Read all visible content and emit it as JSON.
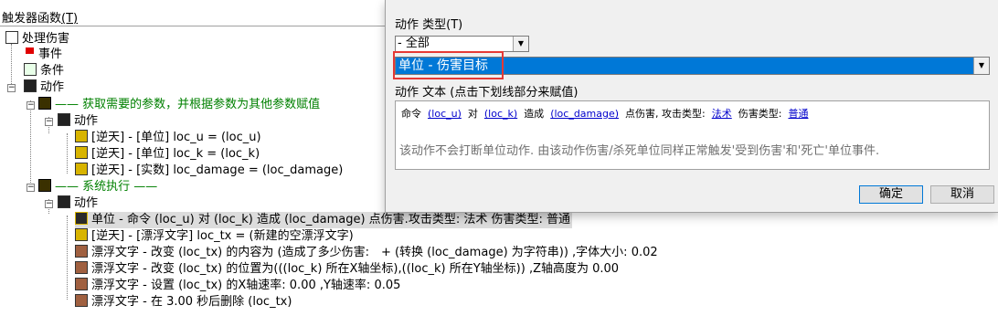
{
  "panel": {
    "title": "触发器函数",
    "title_key": "(T)"
  },
  "tree": {
    "root": "处理伤害",
    "events": "事件",
    "conditions": "条件",
    "actions": "动作",
    "comment1": "—— 获取需要的参数，并根据参数为其他参数赋值",
    "sub_actions1": "动作",
    "set_u": "[逆天] - [单位] loc_u = (loc_u)",
    "set_k": "[逆天] - [单位] loc_k = (loc_k)",
    "set_damage": "[逆天] - [实数] loc_damage = (loc_damage)",
    "comment2": "—— 系统执行 ——",
    "sub_actions2": "动作",
    "cmd_damage": "单位 - 命令 (loc_u) 对 (loc_k) 造成 (loc_damage) 点伤害.攻击类型: 法术 伤害类型: 普通",
    "set_tx": "[逆天] - [漂浮文字] loc_tx = (新建的空漂浮文字)",
    "tx_content": "漂浮文字 - 改变 (loc_tx) 的内容为 (造成了多少伤害:　+ (转换 (loc_damage) 为字符串)) ,字体大小: 0.02",
    "tx_position": "漂浮文字 - 改变 (loc_tx) 的位置为(((loc_k) 所在X轴坐标),((loc_k) 所在Y轴坐标)) ,Z轴高度为 0.00",
    "tx_velocity": "漂浮文字 - 设置 (loc_tx) 的X轴速率: 0.00 ,Y轴速率: 0.05",
    "tx_delete": "漂浮文字 - 在 3.00 秒后删除 (loc_tx)"
  },
  "dialog": {
    "type_label": "动作 类型(T)",
    "type_value": "- 全部",
    "action_value": "单位 - 伤害目标",
    "text_label": "动作 文本 (点击下划线部分来赋值)",
    "text_parts": {
      "p1": "命令",
      "l1": "(loc_u)",
      "p2": "对",
      "l2": "(loc_k)",
      "p3": "造成",
      "l3": "(loc_damage)",
      "p4": "点伤害, 攻击类型:",
      "l4": "法术",
      "p5": "伤害类型:",
      "l5": "普通"
    },
    "description": "该动作不会打断单位动作. 由该动作伤害/杀死单位同样正常触发'受到伤害'和'死亡'单位事件.",
    "ok_label": "确定",
    "cancel_label": "取消"
  },
  "colors": {
    "selection": "#0078d7",
    "highlight_border": "#e53935",
    "comment_green": "#008000",
    "link_blue": "#0000cc"
  }
}
